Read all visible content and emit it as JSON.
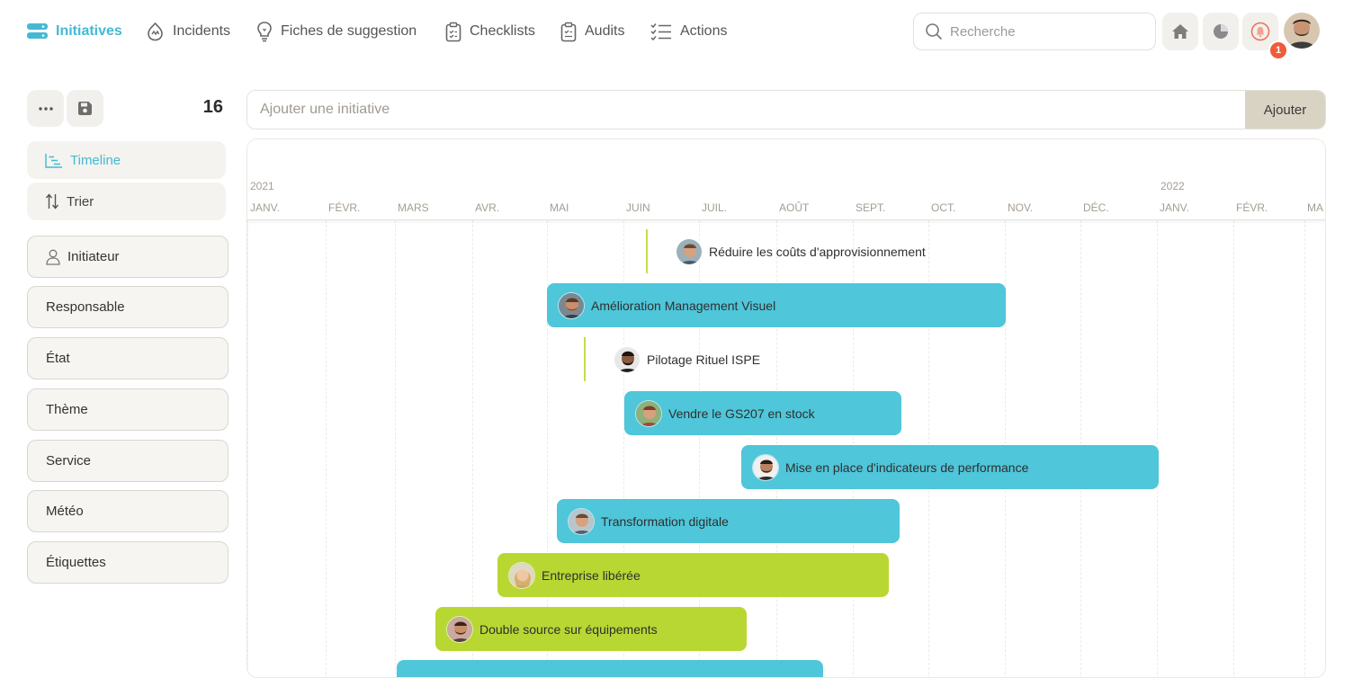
{
  "nav": {
    "items": [
      {
        "label": "Initiatives",
        "icon": "server-stack-icon",
        "active": true
      },
      {
        "label": "Incidents",
        "icon": "flame-icon"
      },
      {
        "label": "Fiches de suggestion",
        "icon": "lightbulb-icon"
      },
      {
        "label": "Checklists",
        "icon": "clipboard-check-icon"
      },
      {
        "label": "Audits",
        "icon": "clipboard-list-icon"
      },
      {
        "label": "Actions",
        "icon": "checklist-icon"
      }
    ],
    "search_placeholder": "Recherche",
    "notification_count": "1"
  },
  "sidebar": {
    "count": "16",
    "views": [
      {
        "label": "Timeline",
        "icon": "timeline-icon",
        "active": true
      },
      {
        "label": "Trier",
        "icon": "sort-icon"
      }
    ],
    "filters": [
      {
        "label": "Initiateur",
        "icon": "user-icon"
      },
      {
        "label": "Responsable"
      },
      {
        "label": "État"
      },
      {
        "label": "Thème"
      },
      {
        "label": "Service"
      },
      {
        "label": "Météo"
      },
      {
        "label": "Étiquettes"
      }
    ]
  },
  "add_initiative": {
    "placeholder": "Ajouter une initiative",
    "button": "Ajouter"
  },
  "timeline": {
    "years": [
      "2021",
      "2022"
    ],
    "months": [
      "JANV.",
      "FÉVR.",
      "MARS",
      "AVR.",
      "MAI",
      "JUIN",
      "JUIL.",
      "AOÛT",
      "SEPT.",
      "OCT.",
      "NOV.",
      "DÉC.",
      "JANV.",
      "FÉVR.",
      "MA"
    ],
    "initiatives": [
      {
        "title": "Réduire les coûts d'approvisionnement",
        "type": "milestone",
        "color": "#c8dc4a"
      },
      {
        "title": "Amélioration Management Visuel",
        "type": "bar",
        "color": "#4fc6d9"
      },
      {
        "title": "Pilotage Rituel ISPE",
        "type": "milestone",
        "color": "#c8dc4a"
      },
      {
        "title": "Vendre le GS207 en stock",
        "type": "bar",
        "color": "#4fc6d9"
      },
      {
        "title": "Mise en place d'indicateurs de performance",
        "type": "bar",
        "color": "#4fc6d9"
      },
      {
        "title": "Transformation digitale",
        "type": "bar",
        "color": "#4fc6d9"
      },
      {
        "title": "Entreprise libérée",
        "type": "bar",
        "color": "#b8d733"
      },
      {
        "title": "Double source sur équipements",
        "type": "bar",
        "color": "#b8d733"
      }
    ]
  },
  "colors": {
    "accent": "#45b9d3",
    "bar_blue": "#4fc6d9",
    "bar_green": "#b8d733",
    "badge": "#ef5b3a"
  }
}
